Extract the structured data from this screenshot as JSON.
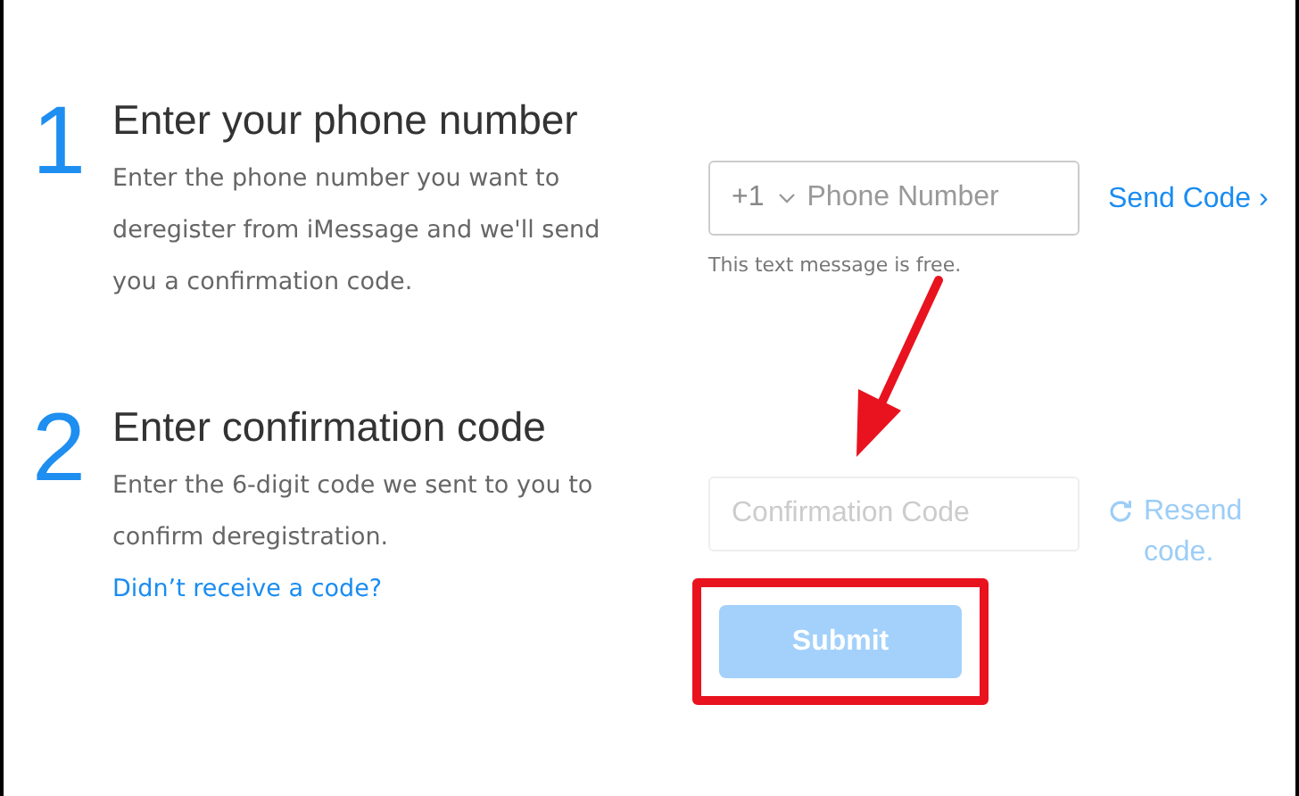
{
  "steps": [
    {
      "number": "1",
      "title": "Enter your phone number",
      "description": "Enter the phone number you want to deregister from iMessage and we'll send you a confirmation code.",
      "field": {
        "kind": "phone",
        "country_code": "+1",
        "placeholder": "Phone Number",
        "disabled": false
      },
      "hint": "This text message is free.",
      "action": {
        "kind": "send",
        "disabled": false,
        "lines": [
          "Send Code ›"
        ]
      }
    },
    {
      "number": "2",
      "title": "Enter confirmation code",
      "description": "Enter the 6-digit code we sent to you to confirm deregistration.",
      "link": "Didn’t receive a code?",
      "field": {
        "kind": "code",
        "placeholder": "Confirmation Code",
        "disabled": true
      },
      "action": {
        "kind": "resend",
        "disabled": true,
        "lines": [
          "Resend",
          "code."
        ]
      }
    }
  ],
  "submit": {
    "label": "Submit",
    "disabled": true,
    "highlighted": true
  },
  "annotation_arrow": true
}
